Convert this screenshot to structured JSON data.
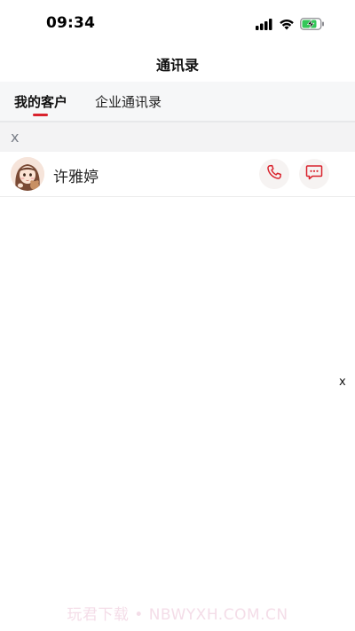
{
  "status_bar": {
    "time": "09:34",
    "icons": [
      "signal-icon",
      "wifi-icon",
      "battery-charging-icon"
    ],
    "battery_color": "#34c759"
  },
  "nav": {
    "title": "通讯录"
  },
  "tabs": [
    {
      "label": "我的客户",
      "active": true
    },
    {
      "label": "企业通讯录",
      "active": false
    }
  ],
  "accent_color": "#d9232d",
  "filter": {
    "clear_label": "x"
  },
  "contacts": [
    {
      "name": "许雅婷",
      "avatar": "avatar-icon",
      "actions": [
        "phone-icon",
        "message-icon"
      ]
    }
  ],
  "floating": {
    "close_label": "x"
  },
  "watermark": "玩君下载 • NBWYXH.COM.CN"
}
